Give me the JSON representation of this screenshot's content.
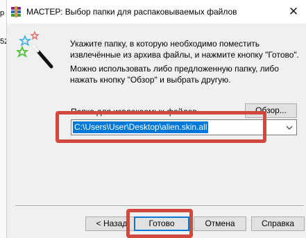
{
  "background_window": {
    "label_top": "р",
    "label_mid": "52"
  },
  "titlebar": {
    "title": "МАСТЕР:  Выбор папки для распаковываемых файлов",
    "close_glyph": "✕"
  },
  "instructions": {
    "line1": "Укажите папку, в которую необходимо поместить извлечённые из архива файлы, и нажмите кнопку \"Готово\".",
    "line2": "Можно использовать либо предложенную папку, либо нажать кнопку \"Обзор\" и выбрать другую."
  },
  "folder": {
    "label": "Папка для извлекаемых файлов",
    "path": "C:\\Users\\User\\Desktop\\alien.skin.all",
    "browse_label": "Обзор..."
  },
  "buttons": {
    "back": "< Назад",
    "done": "Готово",
    "cancel": "Отмена",
    "help": "Справка"
  },
  "colors": {
    "highlight": "#d2483f",
    "selection": "#0078d7"
  }
}
